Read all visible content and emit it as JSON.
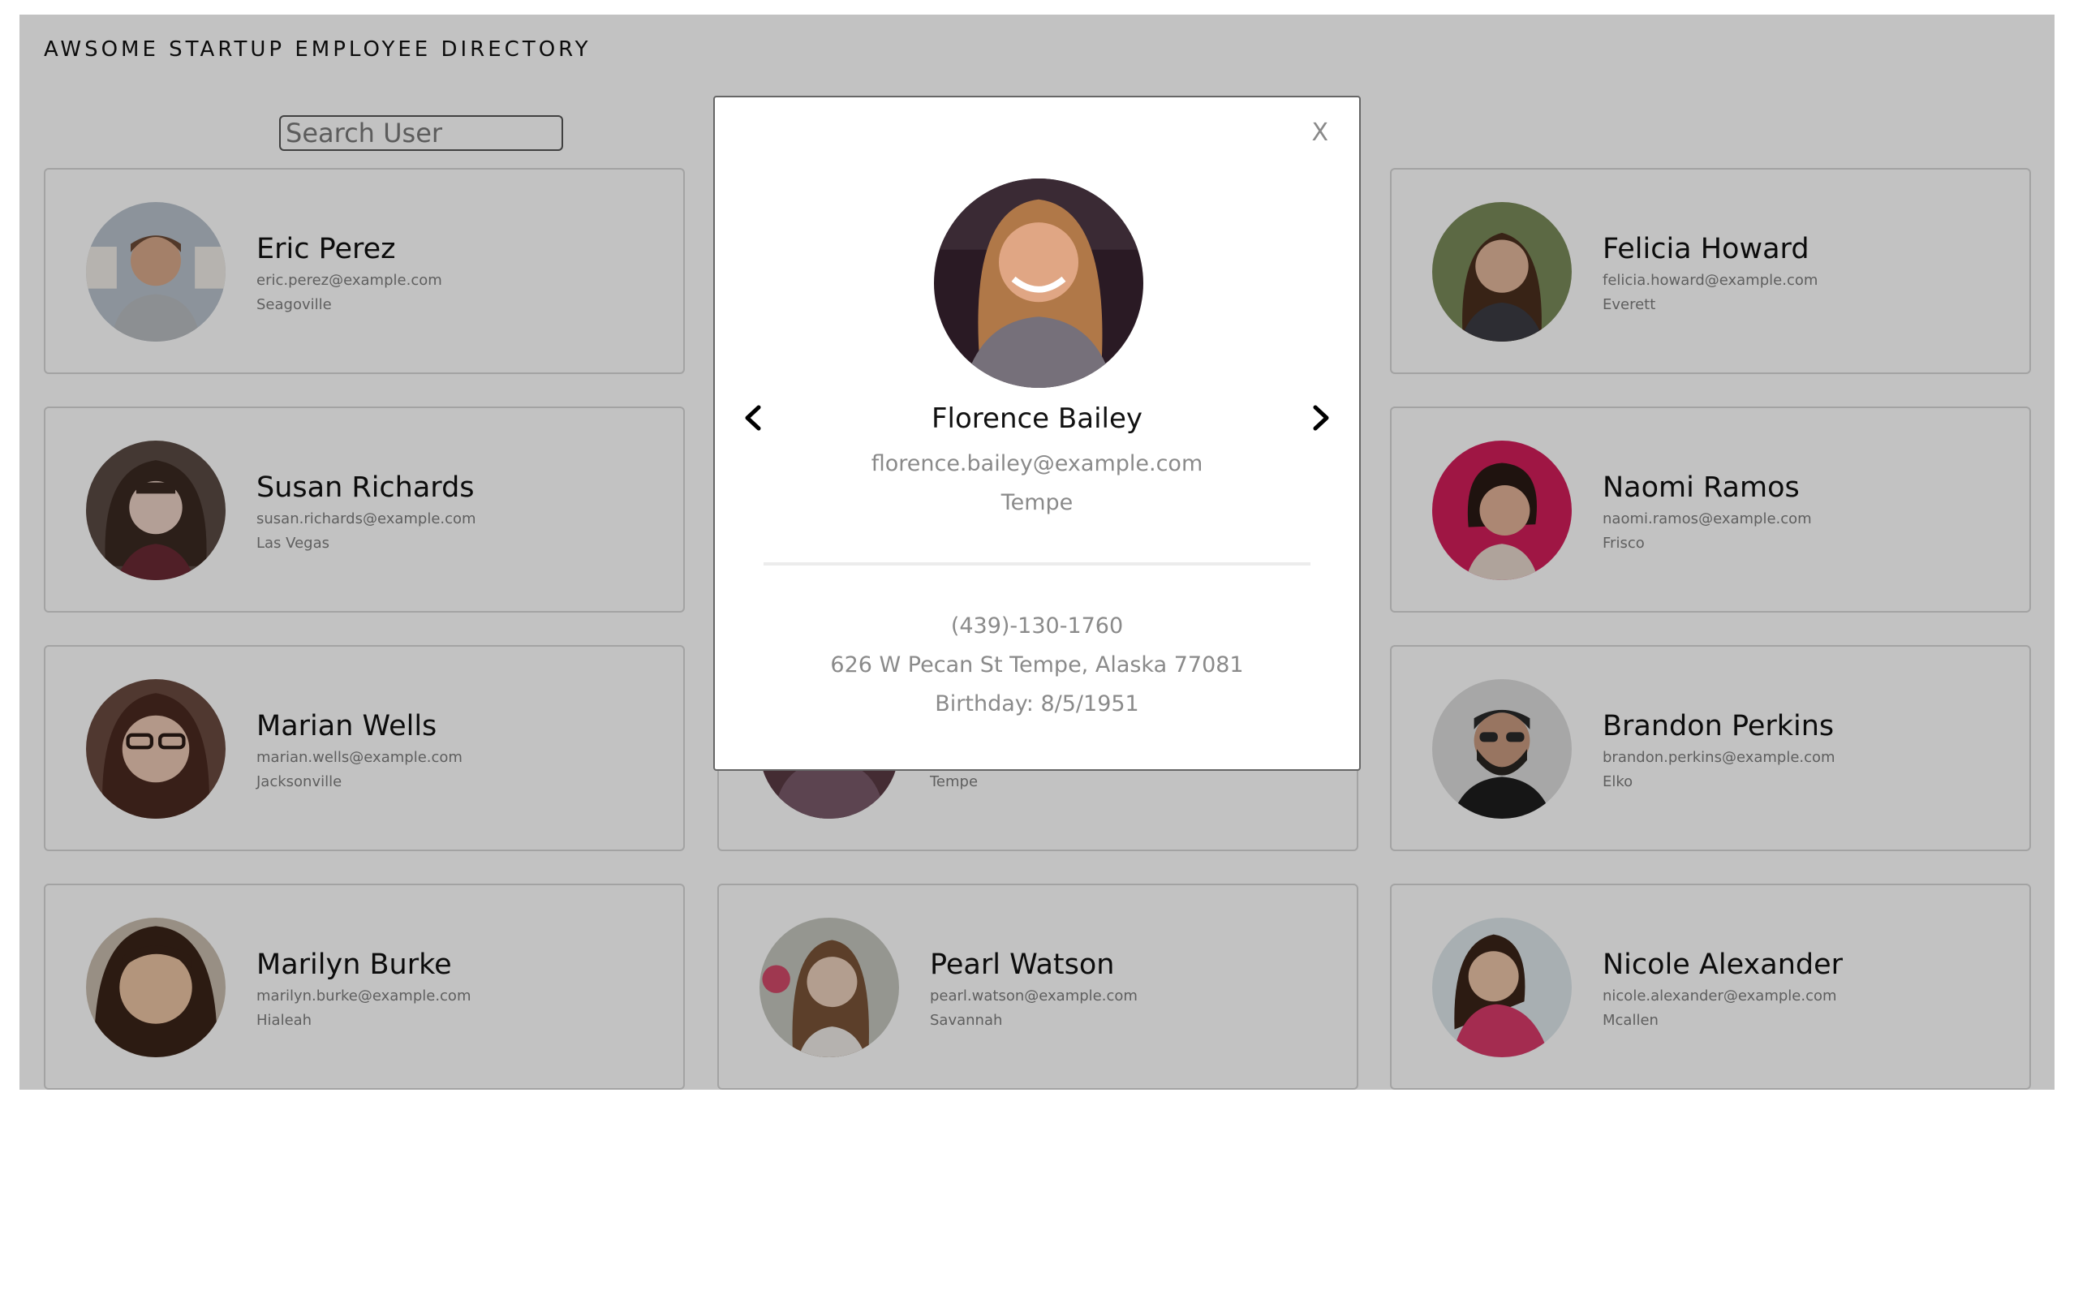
{
  "header": {
    "title": "AWSOME STARTUP EMPLOYEE DIRECTORY"
  },
  "search": {
    "placeholder": "Search User"
  },
  "employees": [
    {
      "name": "Eric Perez",
      "email": "eric.perez@example.com",
      "city": "Seagoville"
    },
    {
      "name": "Felicia Howard",
      "email": "felicia.howard@example.com",
      "city": "Everett"
    },
    {
      "name": "Susan Richards",
      "email": "susan.richards@example.com",
      "city": "Las Vegas"
    },
    {
      "name": "Naomi Ramos",
      "email": "naomi.ramos@example.com",
      "city": "Frisco"
    },
    {
      "name": "Marian Wells",
      "email": "marian.wells@example.com",
      "city": "Jacksonville"
    },
    {
      "name": "",
      "email": "",
      "city": "Tempe"
    },
    {
      "name": "Brandon Perkins",
      "email": "brandon.perkins@example.com",
      "city": "Elko"
    },
    {
      "name": "Marilyn Burke",
      "email": "marilyn.burke@example.com",
      "city": "Hialeah"
    },
    {
      "name": "Pearl Watson",
      "email": "pearl.watson@example.com",
      "city": "Savannah"
    },
    {
      "name": "Nicole Alexander",
      "email": "nicole.alexander@example.com",
      "city": "Mcallen"
    }
  ],
  "modal": {
    "close_label": "X",
    "name": "Florence Bailey",
    "email": "florence.bailey@example.com",
    "city": "Tempe",
    "phone": "(439)-130-1760",
    "address": "626 W Pecan St Tempe, Alaska 77081",
    "birthday": "Birthday: 8/5/1951"
  }
}
